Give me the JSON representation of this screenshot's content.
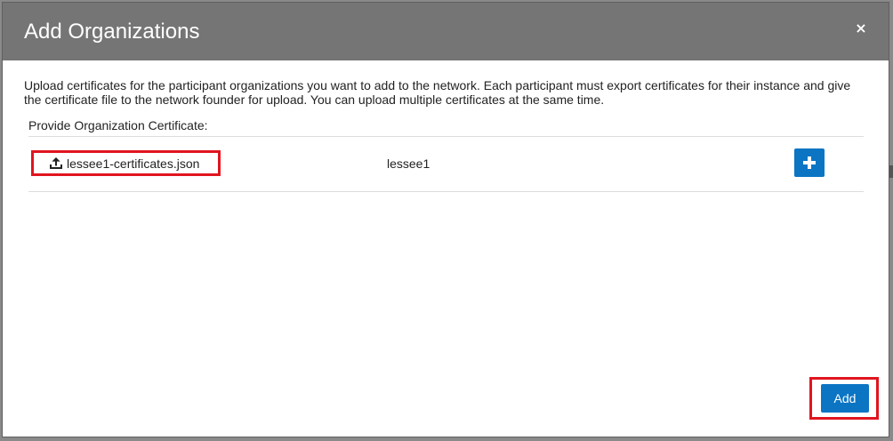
{
  "dialog": {
    "title": "Add Organizations",
    "close_label": "×",
    "description": "Upload certificates for the participant organizations you want to add to the network. Each participant must export certificates for their instance and give the certificate file to the network founder for upload. You can upload multiple certificates at the same time.",
    "section_label": "Provide Organization Certificate:"
  },
  "certificate_row": {
    "file_name": "lessee1-certificates.json",
    "organization": "lessee1",
    "upload_icon": "upload-icon",
    "add_row_icon": "plus-icon"
  },
  "footer": {
    "add_label": "Add"
  },
  "colors": {
    "header": "#757575",
    "primary_button": "#0b75c4",
    "highlight": "#e0151f"
  }
}
